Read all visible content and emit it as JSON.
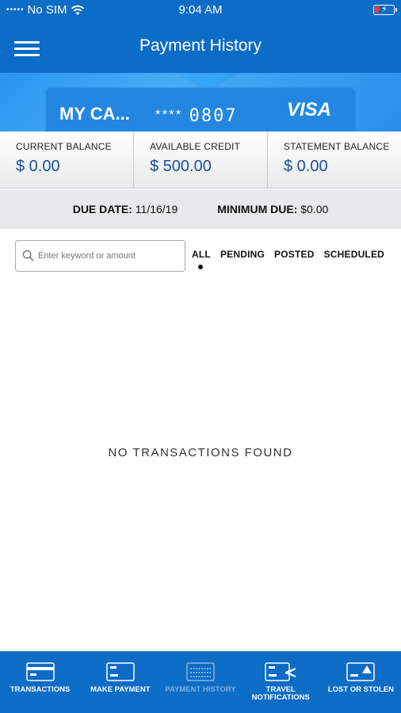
{
  "status_bar": {
    "carrier": "No SIM",
    "time": "9:04 AM"
  },
  "header": {
    "title": "Payment History"
  },
  "card": {
    "name": "MY CA...",
    "masked": "****",
    "last4": "0807",
    "brand": "VISA"
  },
  "balances": [
    {
      "label": "CURRENT BALANCE",
      "value": "$ 0.00"
    },
    {
      "label": "AVAILABLE CREDIT",
      "value": "$ 500.00"
    },
    {
      "label": "STATEMENT BALANCE",
      "value": "$ 0.00"
    }
  ],
  "due": {
    "due_label": "DUE DATE:",
    "due_value": "11/16/19",
    "min_label": "MINIMUM DUE:",
    "min_value": "$0.00"
  },
  "search": {
    "placeholder": "Enter keyword or amount"
  },
  "filters": [
    {
      "label": "ALL",
      "active": true
    },
    {
      "label": "PENDING"
    },
    {
      "label": "POSTED"
    },
    {
      "label": "SCHEDULED"
    }
  ],
  "empty_message": "NO TRANSACTIONS FOUND",
  "bottom_nav": [
    {
      "label": "TRANSACTIONS",
      "icon": "card-icon"
    },
    {
      "label": "MAKE PAYMENT",
      "icon": "card-icon"
    },
    {
      "label": "PAYMENT HISTORY",
      "icon": "card-icon",
      "active": true
    },
    {
      "label": "TRAVEL NOTIFICATIONS",
      "icon": "card-plane-icon"
    },
    {
      "label": "LOST OR STOLEN",
      "icon": "card-alert-icon"
    }
  ],
  "colors": {
    "primary": "#0d6cc6",
    "banner": "#2387e2",
    "value_text": "#1a4f9a"
  }
}
